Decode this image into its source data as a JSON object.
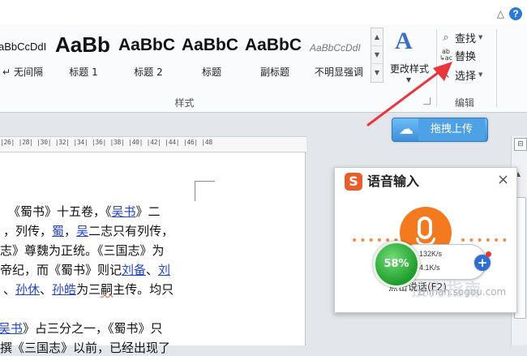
{
  "ribbon": {
    "styles": [
      {
        "sample": "aBbCcDdI",
        "name": "无间隔",
        "prefix": "↵"
      },
      {
        "sample": "AaBb",
        "name": "标题 1"
      },
      {
        "sample": "AaBbC",
        "name": "标题 2"
      },
      {
        "sample": "AaBbC",
        "name": "标题"
      },
      {
        "sample": "AaBbC",
        "name": "副标题"
      },
      {
        "sample": "AaBbCcDdI",
        "name": "不明显强调"
      }
    ],
    "change_styles_label": "更改样式",
    "edit": {
      "find": "查找",
      "replace": "替换",
      "select": "选择"
    },
    "group_styles": "样式",
    "group_edit": "编辑"
  },
  "upload_button": "拖拽上传",
  "ruler_text": "|26| |28| |30| |32| |34| |36| |38| |40| |42| |44| |46| |48",
  "document": {
    "lines": [
      [
        {
          "t": "《蜀书》十五卷，《"
        },
        {
          "t": "吴书",
          "link": true
        },
        {
          "t": "》二"
        }
      ],
      [
        {
          "t": "，列传，"
        },
        {
          "t": "蜀",
          "link": true
        },
        {
          "t": "，"
        },
        {
          "t": "吴",
          "link": true
        },
        {
          "t": "二志只有列传，"
        }
      ],
      [
        {
          "t": "志》尊魏为正统。《三国志》为"
        }
      ],
      [
        {
          "t": "帝纪，而《蜀书》则记"
        },
        {
          "t": "刘备",
          "link": true
        },
        {
          "t": "、"
        },
        {
          "t": "刘",
          "link": true
        }
      ],
      [
        {
          "t": "、"
        },
        {
          "t": "孙休",
          "link": true
        },
        {
          "t": "、"
        },
        {
          "t": "孙皓",
          "link": true
        },
        {
          "t": "为三"
        },
        {
          "t": "嗣",
          "wavy": true
        },
        {
          "t": "主传。均只"
        }
      ],
      [
        {
          "t": ""
        }
      ],
      [
        {
          "t": "吴书",
          "link": true
        },
        {
          "t": "》占三分之一，《蜀书》只"
        }
      ],
      [
        {
          "t": "撰《三国志》以前，已经出现了"
        }
      ]
    ]
  },
  "voice_input": {
    "title": "语音输入",
    "close": "×",
    "hint": "点击说话(F2)",
    "watermark": "zhinan.sogou.com",
    "watermark_big": "搜狗指南"
  },
  "speed_widget": {
    "percent": "58%",
    "up": "132K/s",
    "down": "4.1K/s",
    "plus": "+"
  },
  "colors": {
    "annotation_arrow": "#e8363a",
    "mic_orange": "#f47a20"
  }
}
